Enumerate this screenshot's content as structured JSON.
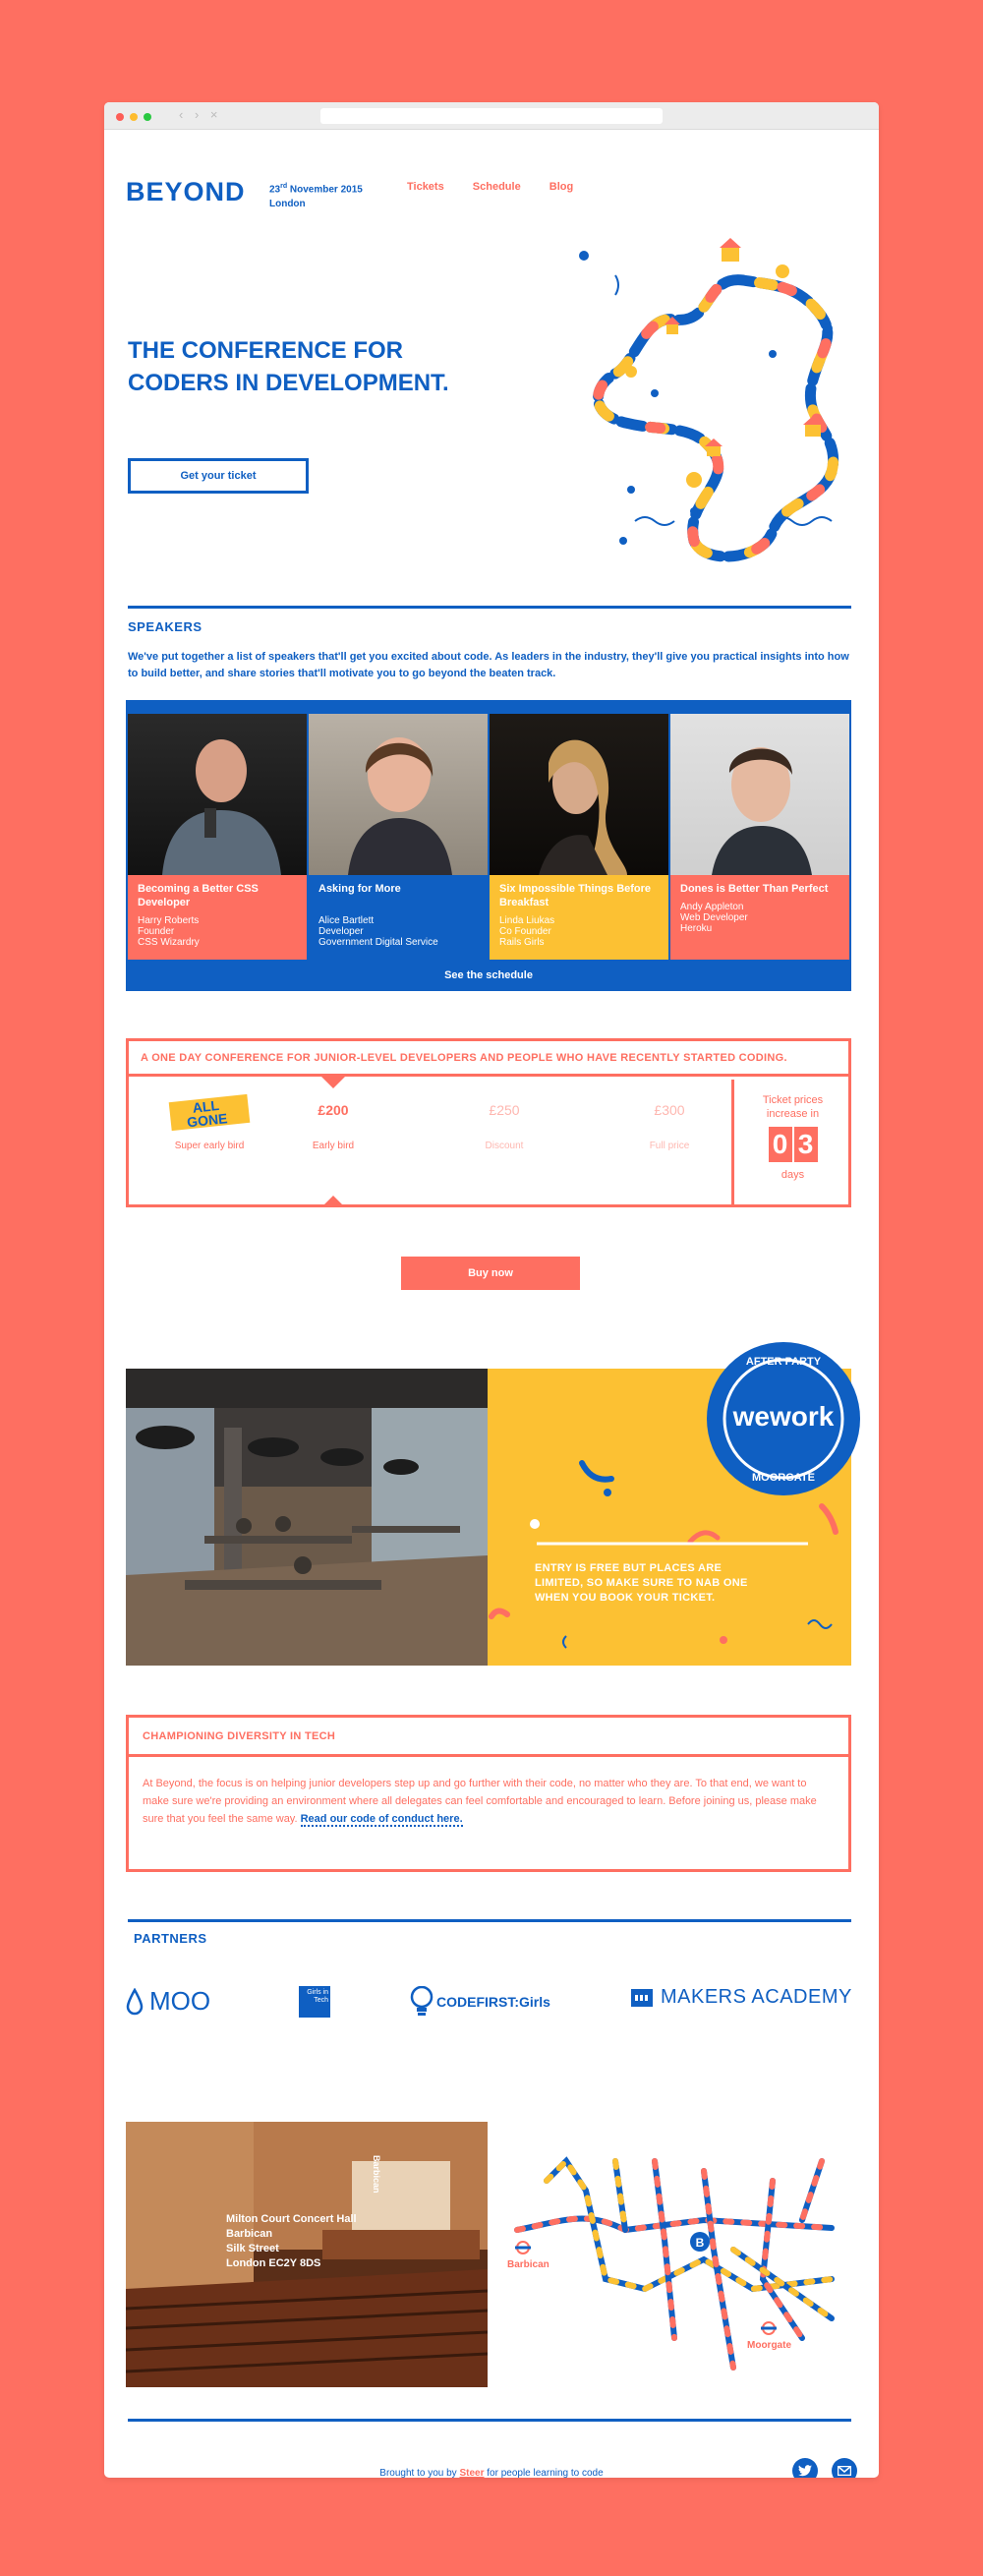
{
  "colors": {
    "accent": "#0f5fc2",
    "coral": "#fe6f61",
    "yellow": "#fcc133"
  },
  "header": {
    "logo": "BEYOND",
    "date_day": "23",
    "date_sup": "rd",
    "date_rest": " November 2015",
    "location": "London",
    "nav": [
      "Tickets",
      "Schedule",
      "Blog"
    ]
  },
  "hero": {
    "headline": "THE CONFERENCE FOR CODERS IN DEVELOPMENT.",
    "button": "Get your ticket"
  },
  "speakers": {
    "heading": "SPEAKERS",
    "intro": "We've put together a list of speakers that'll get you excited about code. As leaders in the industry, they'll give you practical insights into how to build better, and share stories that'll motivate you to go beyond the beaten track.",
    "items": [
      {
        "title": "Becoming a Better CSS Developer",
        "name": "Harry Roberts",
        "role": "Founder",
        "org": "CSS Wizardry",
        "color": "#fe6f61"
      },
      {
        "title": "Asking for More",
        "name": "Alice Bartlett",
        "role": "Developer",
        "org": "Government Digital Service",
        "color": "#0f5fc2"
      },
      {
        "title": "Six Impossible Things Before Breakfast",
        "name": "Linda Liukas",
        "role": "Co Founder",
        "org": "Rails Girls",
        "color": "#fcc133"
      },
      {
        "title": "Dones is Better Than Perfect",
        "name": "Andy Appleton",
        "role": "Web Developer",
        "org": "Heroku",
        "color": "#fe6f61"
      }
    ],
    "schedule_link": "See the schedule"
  },
  "pricing": {
    "banner": "A ONE DAY CONFERENCE FOR JUNIOR-LEVEL DEVELOPERS AND PEOPLE WHO HAVE RECENTLY STARTED CODING.",
    "tiers": [
      {
        "price": "ALL GONE",
        "label": "Super early bird"
      },
      {
        "price": "£200",
        "label": "Early bird"
      },
      {
        "price": "£250",
        "label": "Discount"
      },
      {
        "price": "£300",
        "label": "Full price"
      }
    ],
    "countdown_label": "Ticket prices increase in",
    "countdown_digits": [
      "0",
      "3"
    ],
    "countdown_unit": "days",
    "buy_button": "Buy now"
  },
  "party": {
    "badge_top": "AFTER PARTY",
    "badge_brand": "wework",
    "badge_bottom": "MOORGATE",
    "text": "ENTRY IS FREE BUT PLACES ARE LIMITED, SO MAKE SURE TO NAB ONE WHEN YOU BOOK YOUR TICKET."
  },
  "diversity": {
    "heading": "CHAMPIONING DIVERSITY IN TECH",
    "body": "At Beyond, the focus is on helping junior developers step up and go further with their code, no matter who they are. To that end, we want to make sure we're providing an environment where all delegates can feel comfortable and encouraged to learn. Before joining us, please make sure that you feel the same way. ",
    "link": "Read our code of conduct here."
  },
  "partners": {
    "heading": "PARTNERS",
    "items": [
      "MOO",
      "Girls in Tech",
      "CODEFIRST:Girls",
      "MAKERS ACADEMY"
    ]
  },
  "venue": {
    "lines": [
      "Milton Court Concert Hall",
      "Barbican",
      "Silk Street",
      "London EC2Y 8DS"
    ],
    "sign": "Barbican",
    "map_labels": [
      "Barbican",
      "Moorgate"
    ]
  },
  "footer": {
    "prefix": "Brought to you by ",
    "brand": "Steer",
    "suffix": " for people learning to code"
  }
}
